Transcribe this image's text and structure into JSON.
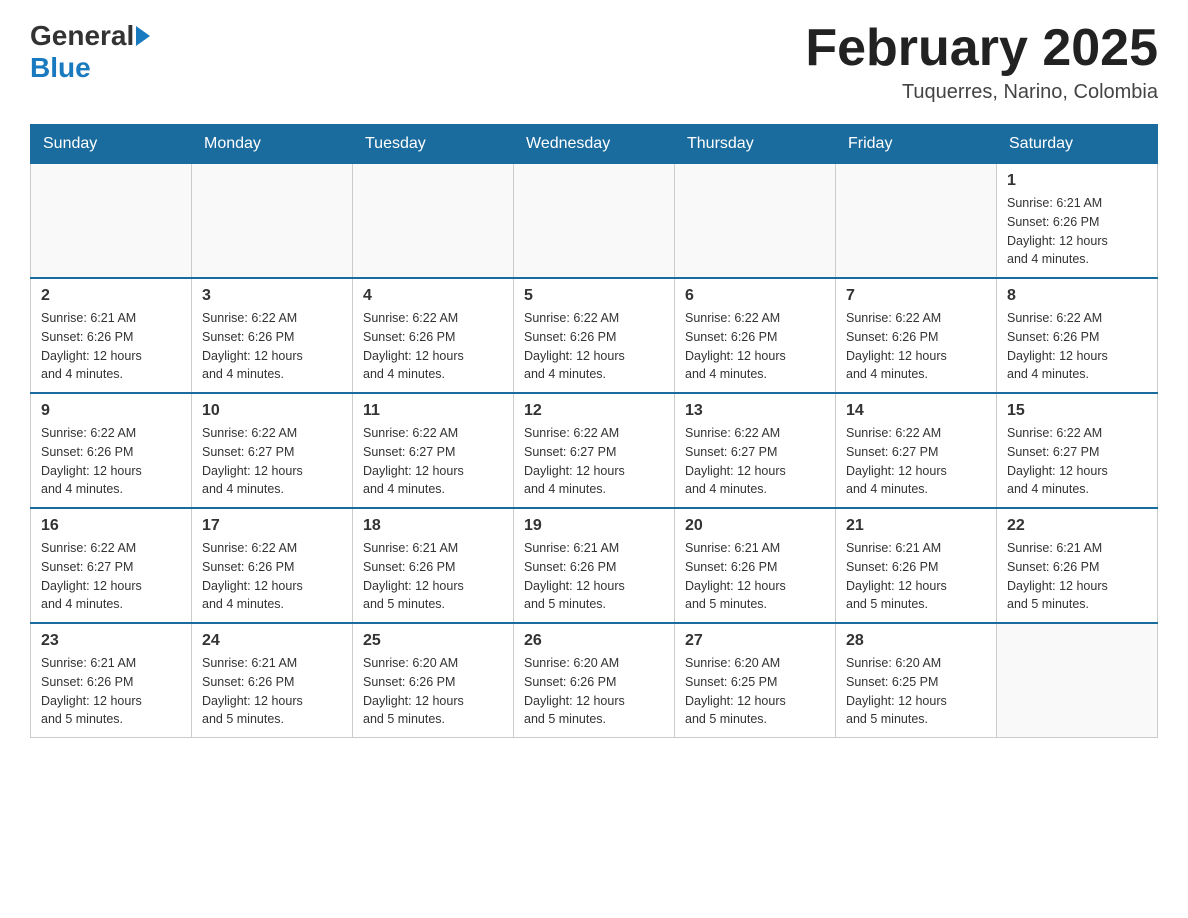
{
  "header": {
    "logo_general": "General",
    "logo_blue": "Blue",
    "title": "February 2025",
    "location": "Tuquerres, Narino, Colombia"
  },
  "days_of_week": [
    "Sunday",
    "Monday",
    "Tuesday",
    "Wednesday",
    "Thursday",
    "Friday",
    "Saturday"
  ],
  "weeks": [
    {
      "days": [
        {
          "date": "",
          "info": ""
        },
        {
          "date": "",
          "info": ""
        },
        {
          "date": "",
          "info": ""
        },
        {
          "date": "",
          "info": ""
        },
        {
          "date": "",
          "info": ""
        },
        {
          "date": "",
          "info": ""
        },
        {
          "date": "1",
          "info": "Sunrise: 6:21 AM\nSunset: 6:26 PM\nDaylight: 12 hours\nand 4 minutes."
        }
      ]
    },
    {
      "days": [
        {
          "date": "2",
          "info": "Sunrise: 6:21 AM\nSunset: 6:26 PM\nDaylight: 12 hours\nand 4 minutes."
        },
        {
          "date": "3",
          "info": "Sunrise: 6:22 AM\nSunset: 6:26 PM\nDaylight: 12 hours\nand 4 minutes."
        },
        {
          "date": "4",
          "info": "Sunrise: 6:22 AM\nSunset: 6:26 PM\nDaylight: 12 hours\nand 4 minutes."
        },
        {
          "date": "5",
          "info": "Sunrise: 6:22 AM\nSunset: 6:26 PM\nDaylight: 12 hours\nand 4 minutes."
        },
        {
          "date": "6",
          "info": "Sunrise: 6:22 AM\nSunset: 6:26 PM\nDaylight: 12 hours\nand 4 minutes."
        },
        {
          "date": "7",
          "info": "Sunrise: 6:22 AM\nSunset: 6:26 PM\nDaylight: 12 hours\nand 4 minutes."
        },
        {
          "date": "8",
          "info": "Sunrise: 6:22 AM\nSunset: 6:26 PM\nDaylight: 12 hours\nand 4 minutes."
        }
      ]
    },
    {
      "days": [
        {
          "date": "9",
          "info": "Sunrise: 6:22 AM\nSunset: 6:26 PM\nDaylight: 12 hours\nand 4 minutes."
        },
        {
          "date": "10",
          "info": "Sunrise: 6:22 AM\nSunset: 6:27 PM\nDaylight: 12 hours\nand 4 minutes."
        },
        {
          "date": "11",
          "info": "Sunrise: 6:22 AM\nSunset: 6:27 PM\nDaylight: 12 hours\nand 4 minutes."
        },
        {
          "date": "12",
          "info": "Sunrise: 6:22 AM\nSunset: 6:27 PM\nDaylight: 12 hours\nand 4 minutes."
        },
        {
          "date": "13",
          "info": "Sunrise: 6:22 AM\nSunset: 6:27 PM\nDaylight: 12 hours\nand 4 minutes."
        },
        {
          "date": "14",
          "info": "Sunrise: 6:22 AM\nSunset: 6:27 PM\nDaylight: 12 hours\nand 4 minutes."
        },
        {
          "date": "15",
          "info": "Sunrise: 6:22 AM\nSunset: 6:27 PM\nDaylight: 12 hours\nand 4 minutes."
        }
      ]
    },
    {
      "days": [
        {
          "date": "16",
          "info": "Sunrise: 6:22 AM\nSunset: 6:27 PM\nDaylight: 12 hours\nand 4 minutes."
        },
        {
          "date": "17",
          "info": "Sunrise: 6:22 AM\nSunset: 6:26 PM\nDaylight: 12 hours\nand 4 minutes."
        },
        {
          "date": "18",
          "info": "Sunrise: 6:21 AM\nSunset: 6:26 PM\nDaylight: 12 hours\nand 5 minutes."
        },
        {
          "date": "19",
          "info": "Sunrise: 6:21 AM\nSunset: 6:26 PM\nDaylight: 12 hours\nand 5 minutes."
        },
        {
          "date": "20",
          "info": "Sunrise: 6:21 AM\nSunset: 6:26 PM\nDaylight: 12 hours\nand 5 minutes."
        },
        {
          "date": "21",
          "info": "Sunrise: 6:21 AM\nSunset: 6:26 PM\nDaylight: 12 hours\nand 5 minutes."
        },
        {
          "date": "22",
          "info": "Sunrise: 6:21 AM\nSunset: 6:26 PM\nDaylight: 12 hours\nand 5 minutes."
        }
      ]
    },
    {
      "days": [
        {
          "date": "23",
          "info": "Sunrise: 6:21 AM\nSunset: 6:26 PM\nDaylight: 12 hours\nand 5 minutes."
        },
        {
          "date": "24",
          "info": "Sunrise: 6:21 AM\nSunset: 6:26 PM\nDaylight: 12 hours\nand 5 minutes."
        },
        {
          "date": "25",
          "info": "Sunrise: 6:20 AM\nSunset: 6:26 PM\nDaylight: 12 hours\nand 5 minutes."
        },
        {
          "date": "26",
          "info": "Sunrise: 6:20 AM\nSunset: 6:26 PM\nDaylight: 12 hours\nand 5 minutes."
        },
        {
          "date": "27",
          "info": "Sunrise: 6:20 AM\nSunset: 6:25 PM\nDaylight: 12 hours\nand 5 minutes."
        },
        {
          "date": "28",
          "info": "Sunrise: 6:20 AM\nSunset: 6:25 PM\nDaylight: 12 hours\nand 5 minutes."
        },
        {
          "date": "",
          "info": ""
        }
      ]
    }
  ]
}
